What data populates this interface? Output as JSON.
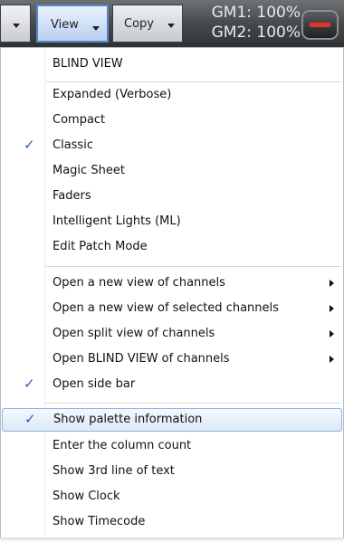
{
  "toolbar": {
    "view_label": "View",
    "copy_label": "Copy",
    "gm1": "GM1: 100%",
    "gm2": "GM2: 100%",
    "accent_color": "#5b84c8",
    "record_color": "#e2352e"
  },
  "menu": {
    "items": [
      {
        "label": "BLIND VIEW"
      },
      {
        "label": "Expanded (Verbose)"
      },
      {
        "label": "Compact"
      },
      {
        "label": "Classic",
        "checked": true
      },
      {
        "label": "Magic Sheet"
      },
      {
        "label": "Faders"
      },
      {
        "label": "Intelligent Lights (ML)"
      },
      {
        "label": "Edit Patch Mode"
      },
      {
        "label": "Open a new view of channels",
        "submenu": true
      },
      {
        "label": "Open a new view of selected channels",
        "submenu": true
      },
      {
        "label": "Open split view of channels",
        "submenu": true
      },
      {
        "label": "Open BLIND VIEW of channels",
        "submenu": true
      },
      {
        "label": "Open side bar",
        "checked": true
      },
      {
        "label": "Show palette information",
        "checked": true,
        "highlighted": true
      },
      {
        "label": "Enter the column count"
      },
      {
        "label": "Show 3rd line of text"
      },
      {
        "label": "Show Clock"
      },
      {
        "label": "Show Timecode"
      }
    ],
    "check_glyph": "✓",
    "check_color": "#2b5fb5"
  }
}
